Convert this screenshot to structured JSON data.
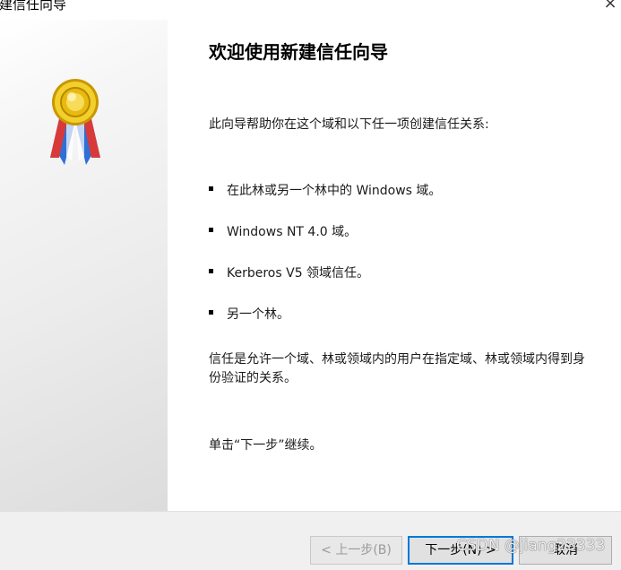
{
  "window": {
    "title": "新建信任向导",
    "close_glyph": "×"
  },
  "content": {
    "heading": "欢迎使用新建信任向导",
    "intro": "此向导帮助你在这个域和以下任一项创建信任关系:",
    "bullets": [
      "在此林或另一个林中的 Windows 域。",
      "Windows NT 4.0 域。",
      "Kerberos V5 领域信任。",
      "另一个林。"
    ],
    "description": "信任是允许一个域、林或领域内的用户在指定域、林或领域内得到身份验证的关系。",
    "continue_text": "单击“下一步”继续。"
  },
  "footer": {
    "back_label": "< 上一步(B)",
    "next_label": "下一步(N) >",
    "cancel_label": "取消",
    "watermark": "CSDN @jiang23333"
  },
  "icons": {
    "side_icon": "award-ribbon-icon",
    "close": "close-icon"
  },
  "colors": {
    "focus_border": "#0078d7",
    "badge_gold": "#e8b90f",
    "ribbon_blue": "#2f6fd6",
    "ribbon_red": "#d83a3a"
  }
}
